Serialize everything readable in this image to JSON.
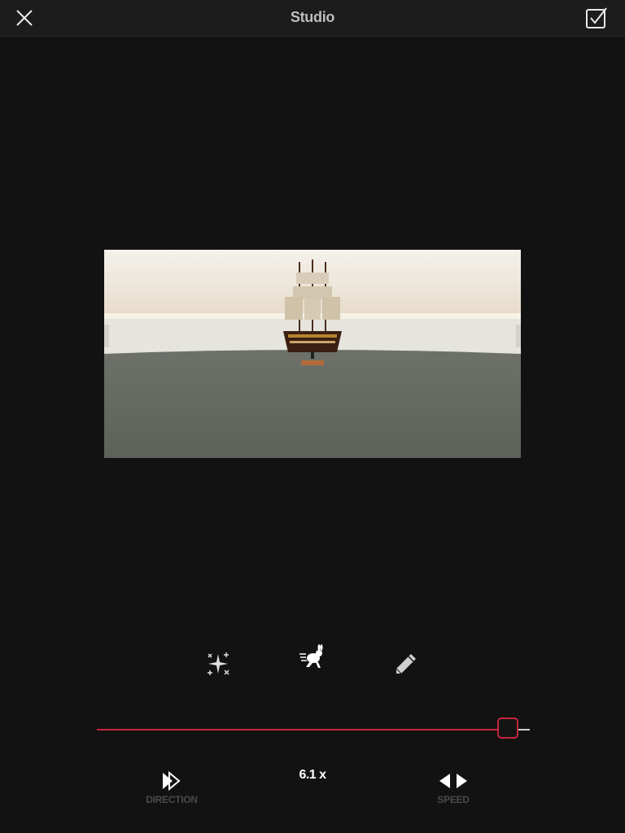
{
  "header": {
    "title": "Studio"
  },
  "tools": {
    "effects_icon": "sparkle-icon",
    "speed_icon": "rabbit-speed-icon",
    "edit_icon": "pencil-icon"
  },
  "speed_slider": {
    "value_fraction": 0.95,
    "accent_color": "#c4263d"
  },
  "speed_value": "6.1 x",
  "controls": {
    "direction_label": "DIRECTION",
    "speed_label": "SPEED"
  }
}
